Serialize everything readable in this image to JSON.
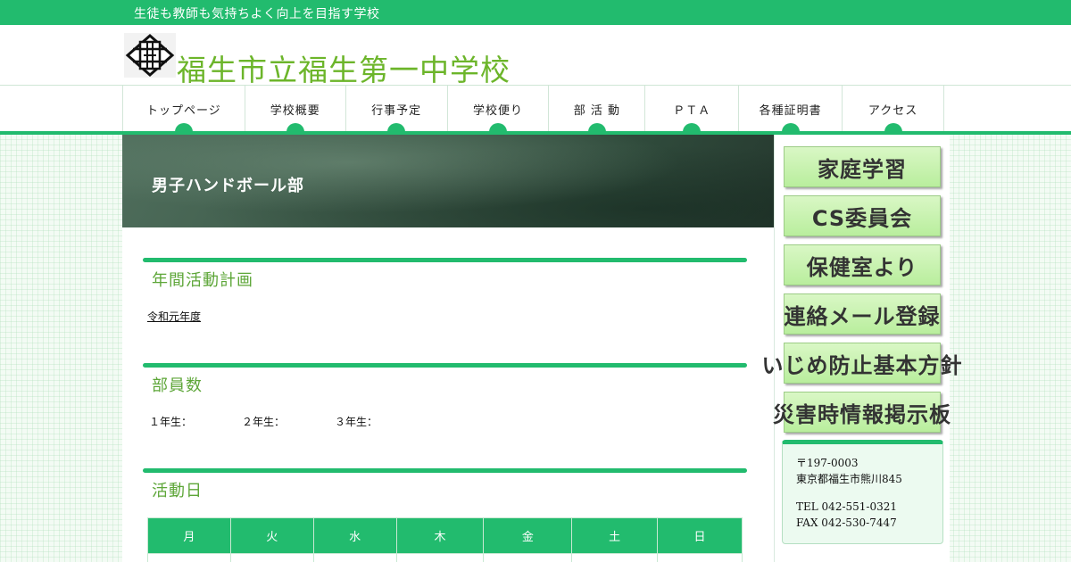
{
  "header": {
    "tagline": "生徒も教師も気持ちよく向上を目指す学校",
    "school_name": "福生市立福生第一中学校",
    "logo_icon": "school-crest-icon"
  },
  "nav": {
    "items": [
      "トップページ",
      "学校概要",
      "行事予定",
      "学校便り",
      "部 活 動",
      "ＰＴＡ",
      "各種証明書",
      "アクセス"
    ]
  },
  "page": {
    "title": "男子ハンドボール部",
    "sections": [
      {
        "title": "年間活動計画",
        "link": "令和元年度"
      },
      {
        "title": "部員数",
        "members": [
          "１年生：",
          "２年生：",
          "３年生："
        ]
      },
      {
        "title": "活動日",
        "days": [
          "月",
          "火",
          "水",
          "木",
          "金",
          "土",
          "日"
        ]
      }
    ]
  },
  "sidebar": {
    "banners": [
      "家庭学習",
      "CS委員会",
      "保健室より",
      "連絡メール登録",
      "いじめ防止基本方針",
      "災害時情報掲示板"
    ],
    "address": {
      "postal": "〒197-0003",
      "street": "東京都福生市熊川845",
      "tel": "TEL 042-551-0321",
      "fax": "FAX 042-530-7447"
    }
  },
  "colors": {
    "accent": "#22bb6e",
    "title_green": "#6cb52a",
    "banner_green": "#c8f2ae"
  }
}
